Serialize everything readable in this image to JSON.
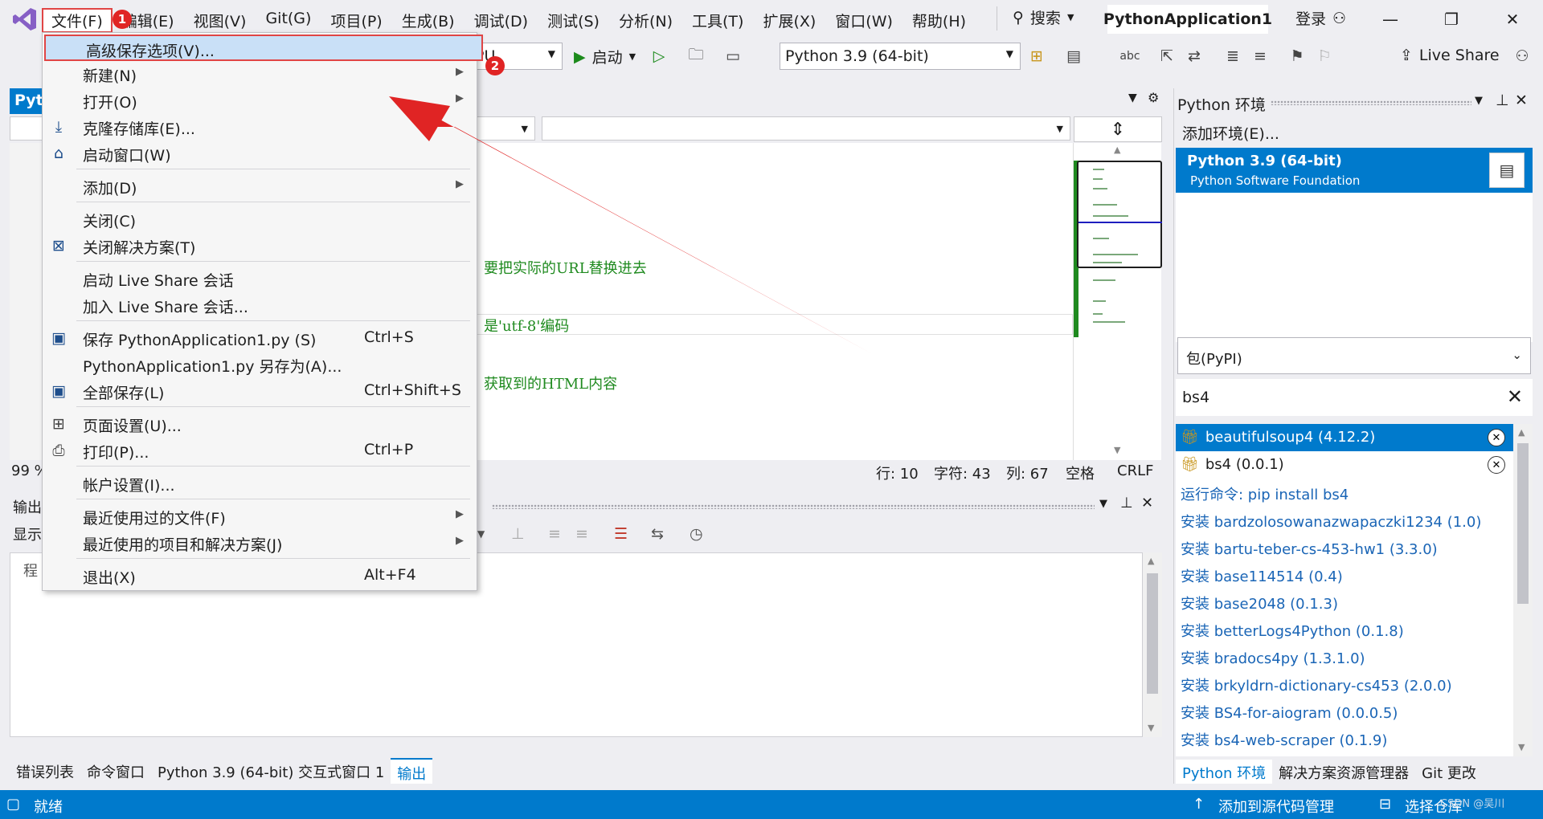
{
  "menubar": {
    "items": [
      "文件(F)",
      "编辑(E)",
      "视图(V)",
      "Git(G)",
      "项目(P)",
      "生成(B)",
      "调试(D)",
      "测试(S)",
      "分析(N)",
      "工具(T)",
      "扩展(X)",
      "窗口(W)",
      "帮助(H)"
    ],
    "search_label": "搜索",
    "solution_title": "PythonApplication1",
    "login_label": "登录"
  },
  "toolbar": {
    "platform": "PU",
    "start_label": "启动",
    "interpreter": "Python 3.9 (64-bit)",
    "liveshare_label": "Live Share"
  },
  "editor": {
    "tab_label": "Pyth",
    "comment_lines": [
      "要把实际的URL替换进去",
      "是'utf-8'编码",
      "获取到的HTML内容"
    ],
    "zoom": "99 %",
    "status": {
      "line": "行: 10",
      "char": "字符: 43",
      "col": "列: 67",
      "indent": "空格",
      "eol": "CRLF"
    }
  },
  "output_panel": {
    "title": "输出",
    "show_label": "显示",
    "content_prefix": "程"
  },
  "bottom_tabs": [
    "错误列表",
    "命令窗口",
    "Python 3.9 (64-bit) 交互式窗口 1",
    "输出"
  ],
  "python_env_panel": {
    "title": "Python 环境",
    "add_env": "添加环境(E)...",
    "env_name": "Python 3.9 (64-bit)",
    "env_vendor": "Python Software Foundation",
    "package_source": "包(PyPI)",
    "search_value": "bs4",
    "installed": [
      {
        "label": "beautifulsoup4 (4.12.2)"
      },
      {
        "label": "bs4 (0.0.1)"
      }
    ],
    "run_command": "运行命令: pip install bs4",
    "install_items": [
      "安装 bardzolosowanazwapaczki1234 (1.0)",
      "安装 bartu-teber-cs-453-hw1 (3.3.0)",
      "安装 base114514 (0.4)",
      "安装 base2048 (0.1.3)",
      "安装 betterLogs4Python (0.1.8)",
      "安装 bradocs4py (1.3.1.0)",
      "安装 brkyldrn-dictionary-cs453 (2.0.0)",
      "安装 BS4-for-aiogram (0.0.0.5)",
      "安装 bs4-web-scraper (0.1.9)"
    ],
    "tabs": [
      "Python 环境",
      "解决方案资源管理器",
      "Git 更改"
    ]
  },
  "statusbar": {
    "ready": "就绪",
    "add_source_control": "添加到源代码管理",
    "select_repo": "选择仓库",
    "watermark": "CSDN @吴川"
  },
  "file_menu": {
    "items": [
      {
        "label": "高级保存选项(V)...",
        "shortcut": ""
      },
      {
        "label": "新建(N)",
        "shortcut": ""
      },
      {
        "label": "打开(O)",
        "shortcut": ""
      },
      {
        "label": "克隆存储库(E)...",
        "shortcut": ""
      },
      {
        "label": "启动窗口(W)",
        "shortcut": ""
      },
      {
        "label": "添加(D)",
        "shortcut": ""
      },
      {
        "label": "关闭(C)",
        "shortcut": ""
      },
      {
        "label": "关闭解决方案(T)",
        "shortcut": ""
      },
      {
        "label": "启动 Live Share 会话",
        "shortcut": ""
      },
      {
        "label": "加入 Live Share 会话...",
        "shortcut": ""
      },
      {
        "label": "保存 PythonApplication1.py (S)",
        "shortcut": "Ctrl+S"
      },
      {
        "label": "PythonApplication1.py 另存为(A)...",
        "shortcut": ""
      },
      {
        "label": "全部保存(L)",
        "shortcut": "Ctrl+Shift+S"
      },
      {
        "label": "页面设置(U)...",
        "shortcut": ""
      },
      {
        "label": "打印(P)...",
        "shortcut": "Ctrl+P"
      },
      {
        "label": "帐户设置(I)...",
        "shortcut": ""
      },
      {
        "label": "最近使用过的文件(F)",
        "shortcut": ""
      },
      {
        "label": "最近使用的项目和解决方案(J)",
        "shortcut": ""
      },
      {
        "label": "退出(X)",
        "shortcut": "Alt+F4"
      }
    ]
  },
  "annotations": {
    "badge1": "1",
    "badge2": "2"
  },
  "colors": {
    "accent": "#007acc",
    "highlight_border": "#e04545",
    "badge": "#e02424",
    "comment_green": "#1f8a1f"
  },
  "icons": [
    "vs-logo-icon",
    "search-icon",
    "play-icon",
    "pin-icon",
    "close-icon",
    "gift-icon",
    "save-icon",
    "print-icon",
    "chevron-down-icon"
  ]
}
